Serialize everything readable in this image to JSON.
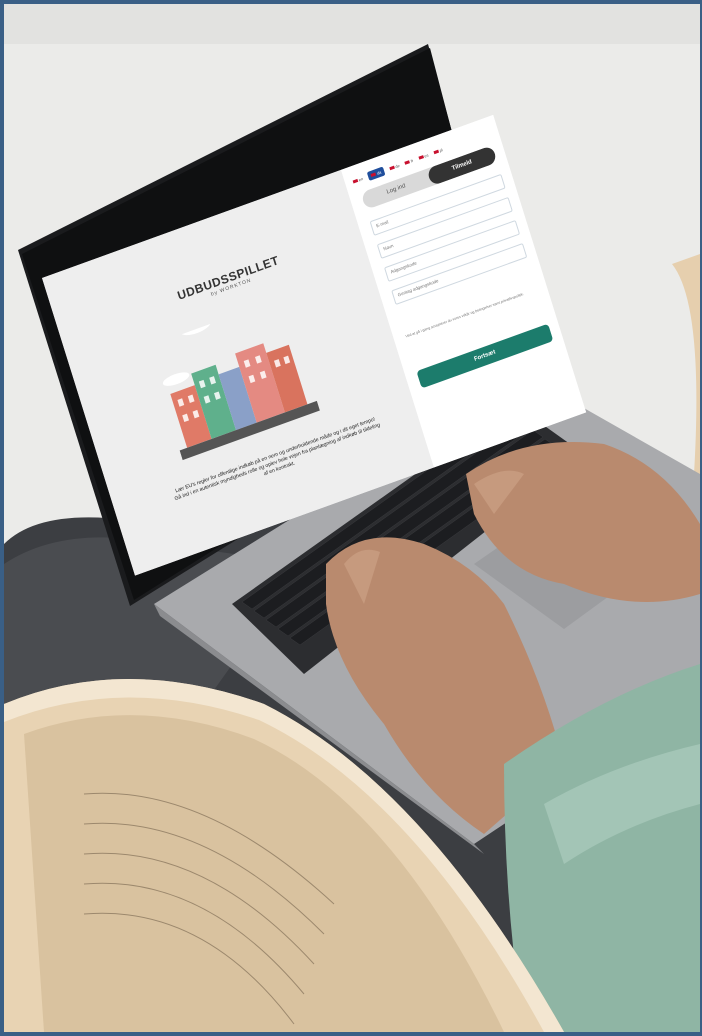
{
  "brand": {
    "title": "UDBUDSSPILLET",
    "subtitle": "by WORKTON"
  },
  "tagline": "Lær EU's regler for offentlige indkøb på en nem og underholdende måde og i dit eget tempo! Gå ind i en autentisk myndigheds rolle og oplev hele vejen fra planlægning af indkøb til tildeling af en kontrakt.",
  "languages": [
    {
      "code": "en"
    },
    {
      "code": "da",
      "active": true
    },
    {
      "code": "de"
    },
    {
      "code": "fr"
    },
    {
      "code": "es"
    },
    {
      "code": "pl"
    }
  ],
  "auth": {
    "tab_login": "Log ind",
    "tab_signup": "Tilmeld",
    "field_email": "E-mail",
    "field_name": "Navn",
    "field_password": "Adgangskode",
    "field_confirm": "Gentag adgangskode",
    "fine_print": "Ved at gå i gang accepterer du vores vilkår og betingelser samt privatlivspolitik.",
    "submit": "Fortsæt"
  },
  "colors": {
    "accent": "#1c7c6c",
    "dark": "#333333",
    "border": "#3a5f86"
  }
}
